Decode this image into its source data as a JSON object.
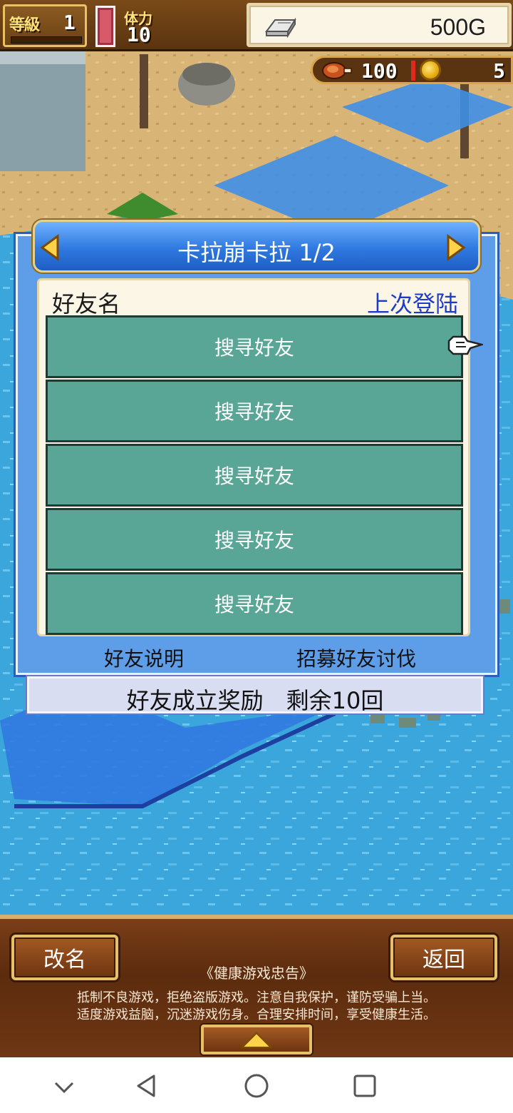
{
  "hud": {
    "level_label": "等級",
    "level_value": "1",
    "stamina_label": "体力",
    "stamina_value": "10",
    "gold": "500G",
    "food": "100",
    "medals": "5"
  },
  "dialog": {
    "title": "卡拉崩卡拉 1/2",
    "header_name": "好友名",
    "header_last_login": "上次登陆",
    "slots": [
      {
        "label": "搜寻好友"
      },
      {
        "label": "搜寻好友"
      },
      {
        "label": "搜寻好友"
      },
      {
        "label": "搜寻好友"
      },
      {
        "label": "搜寻好友"
      }
    ],
    "help_link": "好友说明",
    "recruit_link": "招募好友讨伐",
    "reward_text": "好友成立奖励　剩余10回"
  },
  "bottom": {
    "rename_label": "改名",
    "back_label": "返回",
    "notice_title": "《健康游戏忠告》",
    "notice_line1": "抵制不良游戏，拒绝盗版游戏。注意自我保护，谨防受骗上当。",
    "notice_line2": "适度游戏益脑，沉迷游戏伤身。合理安排时间，享受健康生活。"
  },
  "icons": {
    "gold": "silver-ingot-icon",
    "food": "meat-icon",
    "medal": "coin-icon",
    "pointer": "pointing-hand-icon",
    "prev": "arrow-left-icon",
    "next": "arrow-right-icon",
    "expand": "triangle-up-icon"
  },
  "colors": {
    "slot": "#5aa696",
    "dialog": "#5e9ee8",
    "title_bar": "#2f79e0",
    "last_login_text": "#1d3ccc",
    "bottom_panel": "#5c2c0e"
  }
}
